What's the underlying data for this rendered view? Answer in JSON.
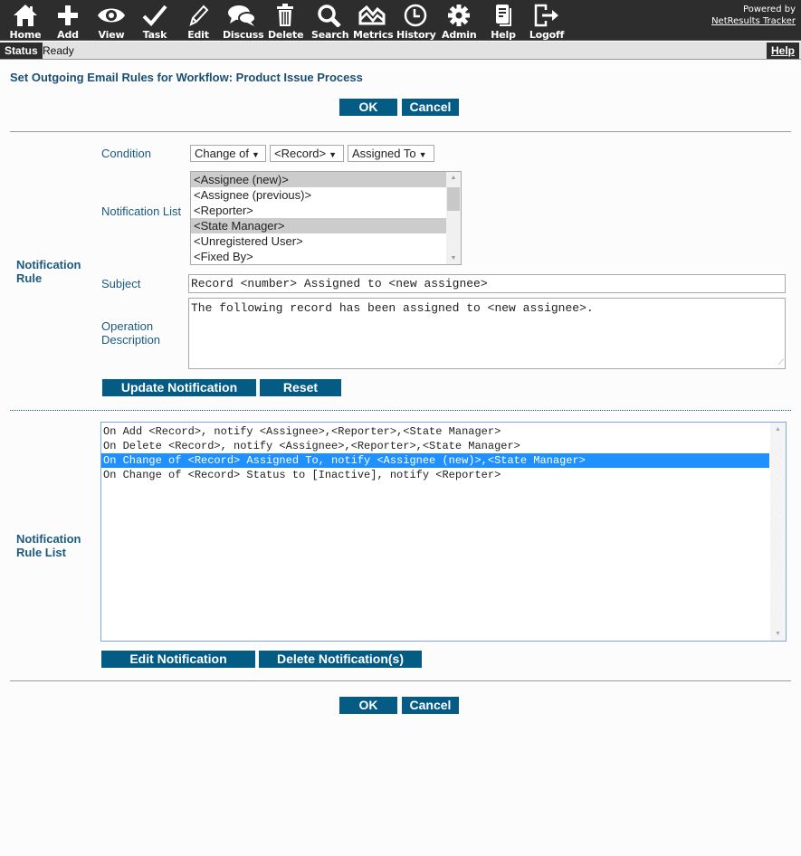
{
  "toolbar": {
    "items": [
      {
        "label": "Home",
        "icon": "home-icon"
      },
      {
        "label": "Add",
        "icon": "plus-icon"
      },
      {
        "label": "View",
        "icon": "eye-icon"
      },
      {
        "label": "Task",
        "icon": "checkmark-icon"
      },
      {
        "label": "Edit",
        "icon": "pencil-icon"
      },
      {
        "label": "Discuss",
        "icon": "chat-bubbles-icon"
      },
      {
        "label": "Delete",
        "icon": "trash-icon"
      },
      {
        "label": "Search",
        "icon": "magnifier-icon"
      },
      {
        "label": "Metrics",
        "icon": "chart-icon"
      },
      {
        "label": "History",
        "icon": "clock-icon"
      },
      {
        "label": "Admin",
        "icon": "gear-icon"
      },
      {
        "label": "Help",
        "icon": "document-icon"
      },
      {
        "label": "Logoff",
        "icon": "logout-icon"
      }
    ],
    "powered_by": "Powered by",
    "brand": "NetResults Tracker"
  },
  "statusbar": {
    "tag": "Status",
    "text": "Ready",
    "help": "Help"
  },
  "page": {
    "title": "Set Outgoing Email Rules for Workflow: Product Issue Process",
    "ok_label": "OK",
    "cancel_label": "Cancel"
  },
  "notification_rule": {
    "section_label": "Notification Rule",
    "condition_label": "Condition",
    "condition": {
      "event": "Change of",
      "record": "<Record>",
      "field": "Assigned To"
    },
    "notification_list_label": "Notification List",
    "notification_list": [
      {
        "label": "<Assignee (new)>",
        "selected": true
      },
      {
        "label": "<Assignee (previous)>",
        "selected": false
      },
      {
        "label": "<Reporter>",
        "selected": false
      },
      {
        "label": "<State Manager>",
        "selected": true
      },
      {
        "label": "<Unregistered User>",
        "selected": false
      },
      {
        "label": "<Fixed By>",
        "selected": false
      }
    ],
    "subject_label": "Subject",
    "subject_value": "Record <number> Assigned to <new assignee>",
    "description_label": "Operation Description",
    "description_value": "The following record has been assigned to <new assignee>.",
    "update_label": "Update Notification",
    "reset_label": "Reset"
  },
  "rule_list": {
    "section_label": "Notification Rule List",
    "rules": [
      {
        "text": "On Add <Record>, notify <Assignee>,<Reporter>,<State Manager>",
        "selected": false
      },
      {
        "text": "On Delete <Record>, notify <Assignee>,<Reporter>,<State Manager>",
        "selected": false
      },
      {
        "text": "On Change of <Record> Assigned To, notify <Assignee (new)>,<State Manager>",
        "selected": true
      },
      {
        "text": "On Change of <Record> Status to [Inactive], notify <Reporter>",
        "selected": false
      }
    ],
    "edit_label": "Edit Notification",
    "delete_label": "Delete Notification(s)"
  }
}
